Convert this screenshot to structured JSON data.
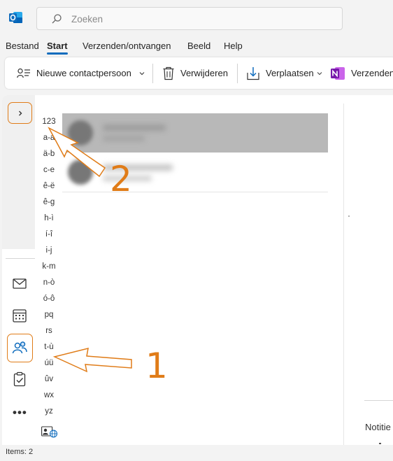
{
  "app": {
    "logo": "outlook-logo-icon",
    "accent": "#0f6cbd",
    "annotation_color": "#e07c18"
  },
  "search": {
    "placeholder": "Zoeken",
    "icon": "search-icon"
  },
  "menu": {
    "items": [
      "Bestand",
      "Start",
      "Verzenden/ontvangen",
      "Beeld",
      "Help"
    ],
    "active": "Start"
  },
  "ribbon": {
    "new_contact": "Nieuwe contactpersoon",
    "delete": "Verwijderen",
    "move": "Verplaatsen",
    "send": "Verzenden"
  },
  "alphabet": [
    "123",
    "a-a",
    "ä-b",
    "c-e",
    "ê-ë",
    "ê-g",
    "h-ì",
    "í-î",
    "i-j",
    "k-m",
    "n-ò",
    "ó-ô",
    "pq",
    "rs",
    "t-ù",
    "úü",
    "ûv",
    "wx",
    "yz"
  ],
  "details": {
    "notes_label": "Notitie"
  },
  "status": {
    "items": "Items: 2"
  },
  "annotations": {
    "one": "1",
    "two": "2"
  }
}
